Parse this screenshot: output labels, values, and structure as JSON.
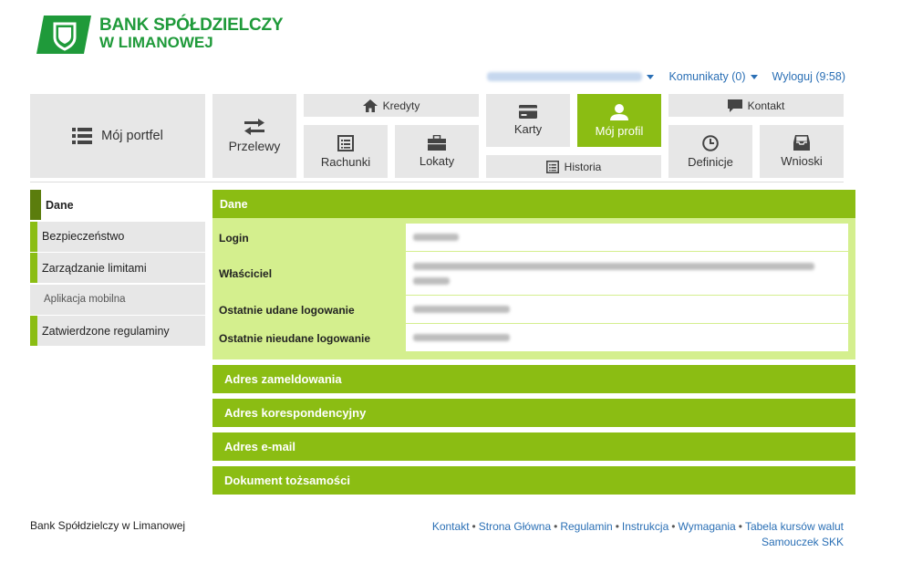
{
  "brand": {
    "line1": "BANK SPÓŁDZIELCZY",
    "line2": "W LIMANOWEJ",
    "color": "#1f9a3a"
  },
  "topbar": {
    "messages": "Komunikaty (0)",
    "logout": "Wyloguj (9:58)"
  },
  "nav": {
    "portfel": "Mój portfel",
    "przelewy": "Przelewy",
    "kredyty": "Kredyty",
    "rachunki": "Rachunki",
    "lokaty": "Lokaty",
    "karty": "Karty",
    "moj_profil": "Mój profil",
    "historia": "Historia",
    "kontakt": "Kontakt",
    "definicje": "Definicje",
    "wnioski": "Wnioski"
  },
  "sidebar": {
    "items": [
      {
        "label": "Dane"
      },
      {
        "label": "Bezpieczeństwo"
      },
      {
        "label": "Zarządzanie limitami"
      },
      {
        "label": "Aplikacja mobilna"
      },
      {
        "label": "Zatwierdzone regulaminy"
      }
    ]
  },
  "panel": {
    "title": "Dane",
    "fields": [
      {
        "label": "Login"
      },
      {
        "label": "Właściciel"
      },
      {
        "label": "Ostatnie udane logowanie"
      },
      {
        "label": "Ostatnie nieudane logowanie"
      }
    ],
    "sections": [
      "Adres zameldowania",
      "Adres korespondencyjny",
      "Adres e-mail",
      "Dokument tożsamości"
    ]
  },
  "footer": {
    "left": "Bank Spółdzielczy w Limanowej",
    "links": [
      "Kontakt",
      "Strona Główna",
      "Regulamin",
      "Instrukcja",
      "Wymagania",
      "Tabela kursów walut",
      "Samouczek SKK"
    ]
  },
  "colors": {
    "accent": "#8bbd13",
    "accent_dark": "#5b7d0d",
    "panel_bg": "#d4ef8e",
    "tile_bg": "#e7e7e7",
    "link": "#2a6fb5"
  }
}
